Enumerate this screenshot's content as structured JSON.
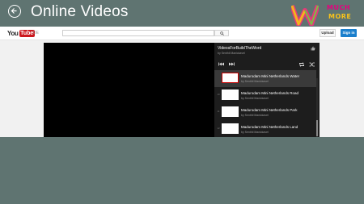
{
  "app": {
    "title": "Online Videos",
    "logo_text_line1": "MUCH",
    "logo_text_line2": "MORE"
  },
  "youtube": {
    "logo_you": "You",
    "logo_tube": "Tube",
    "region": "DE",
    "search_placeholder": "",
    "upload_label": "Upload",
    "signin_label": "Sign in"
  },
  "playlist": {
    "title": "VideosForBuildTheWord",
    "owner": "by Senthil Manickavel",
    "items": [
      {
        "num": "",
        "name": "Madurodam Mini Netherlands Water",
        "by": "by Senthil Manickavel",
        "active": true
      },
      {
        "num": "10",
        "name": "Madurodam Mini Netherlands Road",
        "by": "by Senthil Manickavel",
        "active": false
      },
      {
        "num": "11",
        "name": "Madurodam Mini Netherlands Park",
        "by": "by Senthil Manickavel",
        "active": false
      },
      {
        "num": "12",
        "name": "Madurodam Mini Netherlands Land",
        "by": "by Senthil Manickavel",
        "active": false
      }
    ]
  },
  "colors": {
    "app_background": "#5f7471",
    "youtube_red": "#cc181e",
    "signin_blue": "#1b7fcc",
    "active_item_border": "#cc0000"
  },
  "icons": [
    "back-arrow-icon",
    "search-icon",
    "thumbs-up-icon",
    "previous-icon",
    "next-icon",
    "repeat-icon",
    "shuffle-icon"
  ]
}
